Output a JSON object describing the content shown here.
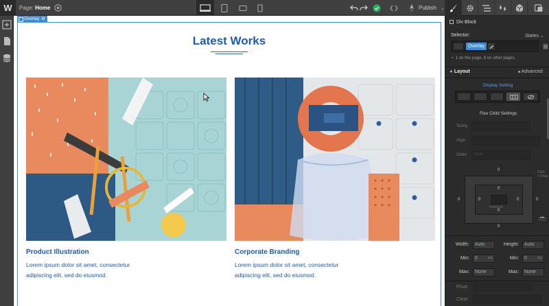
{
  "topbar": {
    "logo": "W",
    "page_prefix": "Page:",
    "page_name": "Home",
    "publish_label": "Publish"
  },
  "overlay_tag": "Overlay",
  "canvas": {
    "title": "Latest Works",
    "works": [
      {
        "title": "Product Illustration",
        "desc": "Lorem ipsum dolor sit amet, consectetur adipiscing elit, sed do eiusmod."
      },
      {
        "title": "Corporate Branding",
        "desc": "Lorem ipsum dolor sit amet, consectetur adipiscing elit, sed do eiusmod."
      }
    ]
  },
  "panel": {
    "element_type": "Div Block",
    "selector_label": "Selector:",
    "states_label": "States",
    "selector_chip": "Overlay",
    "selector_note": "1 on this page, 8 on other pages.",
    "layout_label": "Layout",
    "advanced_label": "Advanced",
    "display_setting": "Display Setting",
    "flex_child": "Flex Child Settings",
    "sizing": "Sizing",
    "align": "Align",
    "order": "Order",
    "order_auto": "Auto",
    "click_drag": "Click\n+ Drag",
    "margin_top": "0",
    "margin_left": "0",
    "margin_right": "0",
    "margin_bottom": "0",
    "padding_top": "0",
    "padding_left": "0",
    "padding_right": "0",
    "padding_bottom": "0",
    "padding_label": "PADDING",
    "width_label": "Width:",
    "width_value": "Auto",
    "height_label": "Height:",
    "height_value": "Auto",
    "min_label": "Min:",
    "min_w": "0",
    "min_h": "0",
    "unit_px": "PX",
    "max_label": "Max:",
    "max_w": "None",
    "max_h": "None",
    "float_label": "Float:",
    "clear_label": "Clear:"
  },
  "colors": {
    "brand_blue": "#1f5ab3",
    "selection_blue": "#3e8bd6",
    "publish_check": "#27ae60"
  }
}
